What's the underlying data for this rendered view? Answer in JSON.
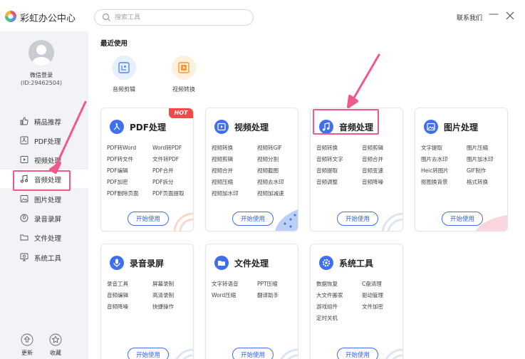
{
  "app": {
    "title": "彩虹办公中心",
    "contact": "联系我们",
    "minimize_label": "—",
    "accent": "#3f6ff0",
    "highlight": "#ee5b8a"
  },
  "search": {
    "placeholder": "搜索工具",
    "value": ""
  },
  "user": {
    "login_label": "微信登录",
    "id_label": "(ID:29462504)"
  },
  "sidebar": {
    "items": [
      {
        "label": "精品推荐",
        "icon": "thumbs-up-icon"
      },
      {
        "label": "PDF处理",
        "icon": "pdf-icon"
      },
      {
        "label": "视频处理",
        "icon": "video-icon"
      },
      {
        "label": "音频处理",
        "icon": "music-note-icon",
        "active": true
      },
      {
        "label": "图片处理",
        "icon": "image-icon"
      },
      {
        "label": "录音录屏",
        "icon": "record-icon"
      },
      {
        "label": "文件处理",
        "icon": "folder-icon"
      },
      {
        "label": "系统工具",
        "icon": "monitor-icon"
      }
    ],
    "bottom": [
      {
        "label": "更新",
        "icon": "update-icon"
      },
      {
        "label": "收藏",
        "icon": "star-icon"
      }
    ]
  },
  "recent": {
    "title": "最近使用",
    "items": [
      {
        "label": "音频剪辑",
        "icon": "audio-cut-icon",
        "color": "#4d86f5",
        "bg": "#e8f0fe"
      },
      {
        "label": "视频转换",
        "icon": "video-convert-icon",
        "color": "#f29a2e",
        "bg": "#fdf0de"
      }
    ]
  },
  "cards": [
    {
      "title": "PDF处理",
      "icon": "pdf-logo-icon",
      "color": "#3f6ff0",
      "badge": "HOT",
      "features": [
        "PDF转Word",
        "Word转PDF",
        "PDF转文件",
        "文件转PDF",
        "PDF编辑",
        "PDF合并",
        "PDF加密",
        "PDF拆分",
        "PDF删除页面",
        "PDF页面提取"
      ],
      "button": "开始使用"
    },
    {
      "title": "视频处理",
      "icon": "video-play-icon",
      "color": "#3f6ff0",
      "features": [
        "视频转换",
        "视频转GIF",
        "视频剪辑",
        "视频分割",
        "视频合并",
        "视频截图",
        "视频压缩",
        "视频去水印",
        "视频加水印",
        "视频加减速"
      ],
      "button": "开始使用"
    },
    {
      "title": "音频处理",
      "icon": "music-note-icon",
      "color": "#3f6ff0",
      "features": [
        "音频转换",
        "音频剪辑",
        "音频转文字",
        "音频合并",
        "音频提取",
        "音频变速",
        "音频调整",
        "音频降噪"
      ],
      "button": "开始使用"
    },
    {
      "title": "图片处理",
      "icon": "image-icon",
      "color": "#3f6ff0",
      "features": [
        "文字提取",
        "图片压缩",
        "图片去水印",
        "图片加水印",
        "Heic转图片",
        "GIF制作",
        "抠图换背景",
        "格式转换"
      ],
      "button": "开始使用"
    },
    {
      "title": "录音录屏",
      "icon": "microphone-icon",
      "color": "#3f6ff0",
      "features": [
        "录音工具",
        "屏幕录制",
        "音频编辑",
        "高清录制",
        "音频降噪",
        "快捷操作"
      ],
      "button": "开始使用"
    },
    {
      "title": "文件处理",
      "icon": "folder-icon",
      "color": "#3f6ff0",
      "features": [
        "文字转语音",
        "PPT压缩",
        "Word压缩",
        "翻译助手"
      ],
      "button": "开始使用"
    },
    {
      "title": "系统工具",
      "icon": "gear-icon",
      "color": "#3f6ff0",
      "features": [
        "数据恢复",
        "C盘清理",
        "大文件搬家",
        "驱动管理",
        "游戏组件",
        "文件加密",
        "定时关机"
      ],
      "button": "开始使用"
    }
  ]
}
